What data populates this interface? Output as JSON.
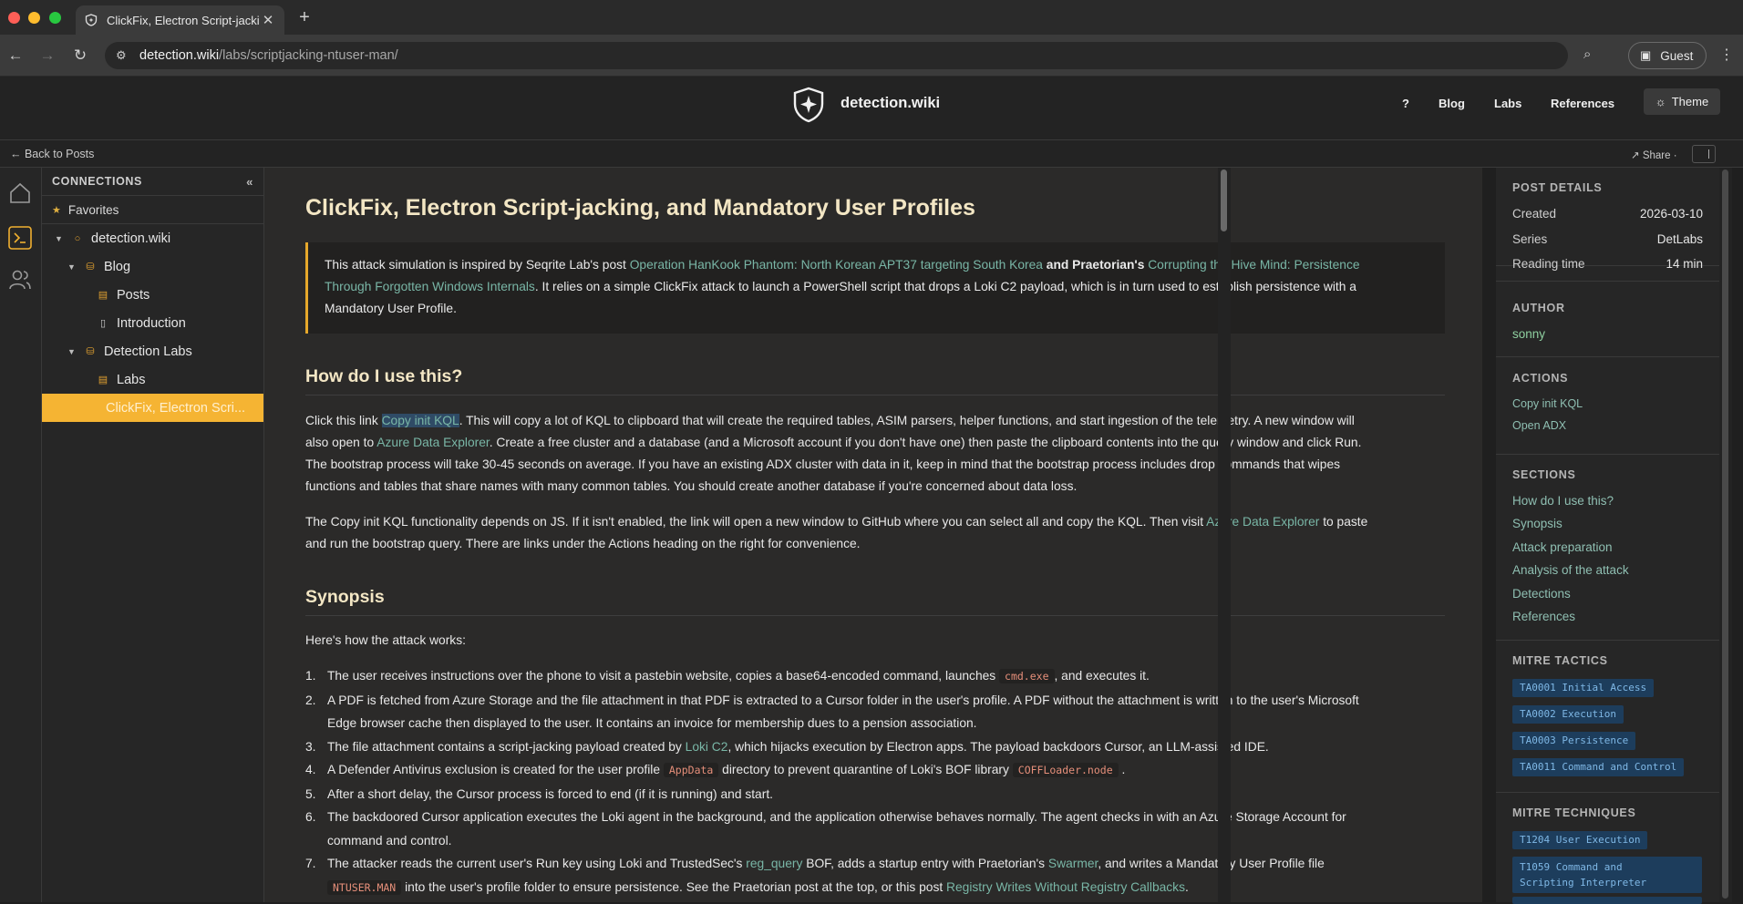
{
  "browser": {
    "tab_title": "ClickFix, Electron Script-jacki",
    "url_domain": "detection.wiki",
    "url_path": "/labs/scriptjacking-ntuser-man/",
    "guest_label": "Guest"
  },
  "site": {
    "name": "detection.wiki",
    "nav": [
      "?",
      "Blog",
      "Labs",
      "References"
    ],
    "theme_label": "Theme",
    "back_label": "← Back to Posts",
    "share_label": "↗ Share ·"
  },
  "sidebar": {
    "header": "CONNECTIONS",
    "favorites": "Favorites",
    "items": [
      {
        "label": "detection.wiki"
      },
      {
        "label": "Blog"
      },
      {
        "label": "Posts"
      },
      {
        "label": "Introduction"
      },
      {
        "label": "Detection Labs"
      },
      {
        "label": "Labs"
      },
      {
        "label": "ClickFix, Electron Scri..."
      }
    ]
  },
  "article": {
    "title": "ClickFix, Electron Script-jacking, and Mandatory User Profiles",
    "callout": {
      "t1": "This attack simulation is inspired by Seqrite Lab's post ",
      "l1": "Operation HanKook Phantom: North Korean APT37 targeting South Korea",
      "t2": " and Praetorian's ",
      "l2a": "Corrupting the Hive Mind: Persistence",
      "l2b": "Through Forgotten Windows Internals",
      "t3": ". It relies on a simple ClickFix attack to launch a PowerShell script that drops a Loki C2 payload, which is in turn used to establish persistence with a",
      "t4": "Mandatory User Profile."
    },
    "h_use": "How do I use this?",
    "p1": {
      "a": "Click this link ",
      "link": "Copy init KQL",
      "b": ". This will copy a lot of KQL to clipboard that will create the required tables, ASIM parsers, helper functions, and start ingestion of the telemetry. A new window will",
      "c": "also open to ",
      "adx": "Azure Data Explorer",
      "d": ". Create a free cluster and a database (and a Microsoft account if you don't have one) then paste the clipboard contents into the query window and click Run.",
      "e": "The bootstrap process will take 30-45 seconds on average. If you have an existing ADX cluster with data in it, keep in mind that the bootstrap process includes drop commands that wipes",
      "f": "functions and tables that share names with many common tables. You should create another database if you're concerned about data loss."
    },
    "p2": {
      "a": "The Copy init KQL functionality depends on JS. If it isn't enabled, the link will open a new window to GitHub where you can select all and copy the KQL. Then visit ",
      "adx": "Azure Data Explorer",
      "b": " to paste",
      "c": "and run the bootstrap query. There are links under the Actions heading on the right for convenience."
    },
    "h_syn": "Synopsis",
    "p3": "Here's how the attack works:",
    "steps": {
      "s1a": "The user receives instructions over the phone to visit a pastebin website, copies a base64-encoded command, launches ",
      "s1code": "cmd.exe",
      "s1b": ", and executes it.",
      "s2a": "A PDF is fetched from Azure Storage and the file attachment in that PDF is extracted to a Cursor folder in the user's profile. A PDF without the attachment is written to the user's Microsoft",
      "s2b": "Edge browser cache then displayed to the user. It contains an invoice for membership dues to a pension association.",
      "s3a": "The file attachment contains a script-jacking payload created by ",
      "s3link": "Loki C2",
      "s3b": ", which hijacks execution by Electron apps. The payload backdoors Cursor, an LLM-assisted IDE.",
      "s4a": "A Defender Antivirus exclusion is created for the user profile ",
      "s4code1": "AppData",
      "s4b": " directory to prevent quarantine of Loki's BOF library ",
      "s4code2": "COFFLoader.node",
      "s4c": " .",
      "s5": "After a short delay, the Cursor process is forced to end (if it is running) and start.",
      "s6a": "The backdoored Cursor application executes the Loki agent in the background, and the application otherwise behaves normally. The agent checks in with an Azure Storage Account for",
      "s6b": "command and control.",
      "s7a": "The attacker reads the current user's Run key using Loki and TrustedSec's ",
      "s7link1": "reg_query",
      "s7b": " BOF, adds a startup entry with Praetorian's ",
      "s7link2": "Swarmer",
      "s7c": ", and writes a Mandatory User Profile file",
      "s7code": "NTUSER.MAN",
      "s7d": " into the user's profile folder to ensure persistence. See the Praetorian post at the top, or this post ",
      "s7link3": "Registry Writes Without Registry Callbacks",
      "s7e": "."
    }
  },
  "right": {
    "post_details": "POST DETAILS",
    "created_k": "Created",
    "created_v": "2026-03-10",
    "series_k": "Series",
    "series_v": "DetLabs",
    "reading_k": "Reading time",
    "reading_v": "14 min",
    "author_h": "AUTHOR",
    "author": "sonny",
    "actions_h": "ACTIONS",
    "action1": "Copy init KQL",
    "action2": "Open ADX",
    "sections_h": "SECTIONS",
    "sections": [
      "How do I use this?",
      "Synopsis",
      "Attack preparation",
      "Analysis of the attack",
      "Detections",
      "References"
    ],
    "tactics_h": "MITRE TACTICS",
    "tactics": [
      "TA0001 Initial Access",
      "TA0002 Execution",
      "TA0003 Persistence",
      "TA0011 Command and Control"
    ],
    "techniques_h": "MITRE TECHNIQUES",
    "tech1": "T1204 User Execution",
    "tech2a": "T1059 Command and",
    "tech2b": "Scripting Interpreter"
  }
}
